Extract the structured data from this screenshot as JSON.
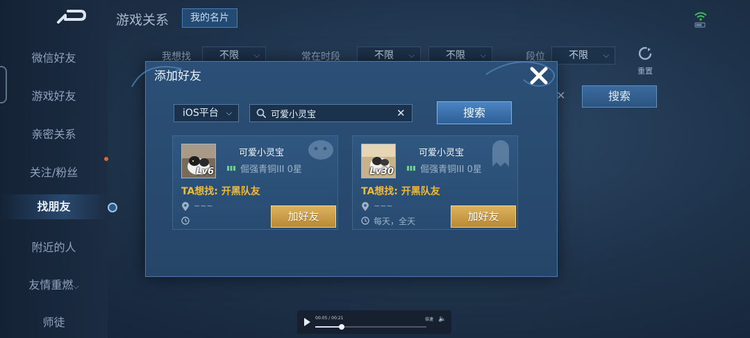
{
  "sidebar": {
    "items": [
      {
        "label": "微信好友"
      },
      {
        "label": "游戏好友"
      },
      {
        "label": "亲密关系"
      },
      {
        "label": "关注/粉丝"
      },
      {
        "label": "找朋友"
      },
      {
        "label": "附近的人"
      },
      {
        "label": "友情重燃"
      },
      {
        "label": "师徒"
      }
    ],
    "active_index": 4
  },
  "header": {
    "title": "游戏关系",
    "card_button": "我的名片"
  },
  "filters": {
    "looking_for_label": "我想找",
    "looking_for_value": "不限",
    "active_time_label": "常在时段",
    "active_time_value_1": "不限",
    "active_time_value_2": "不限",
    "rank_label": "段位",
    "rank_value": "不限",
    "reset_label": "重置",
    "search_button": "搜索"
  },
  "dialog": {
    "title": "添加好友",
    "platform": "iOS平台",
    "search_value": "可爱小灵宝",
    "search_button": "搜索",
    "results": [
      {
        "name": "可爱小灵宝",
        "level": "Lv6",
        "rank": "倔强青铜III 0星",
        "wants": "TA想找: 开黑队友",
        "location": "~~~",
        "time": "",
        "add_button": "加好友"
      },
      {
        "name": "可爱小灵宝",
        "level": "Lv30",
        "rank": "倔强青铜III 0星",
        "wants": "TA想找: 开黑队友",
        "location": "~~~",
        "time": "每天，全天",
        "add_button": "加好友"
      }
    ]
  },
  "player": {
    "time": "00:05 / 00:21",
    "speed": "倍速",
    "progress": 0.24
  },
  "colors": {
    "accent_gold": "#f2b938",
    "button_blue": "#2f5f96",
    "add_button_gold": "#dcb25e"
  },
  "icons": [
    "back-icon",
    "wifi-icon",
    "reset-icon",
    "close-icon",
    "search-icon",
    "clear-icon",
    "rank-icon",
    "location-icon",
    "clock-icon",
    "play-icon",
    "volume-icon"
  ]
}
